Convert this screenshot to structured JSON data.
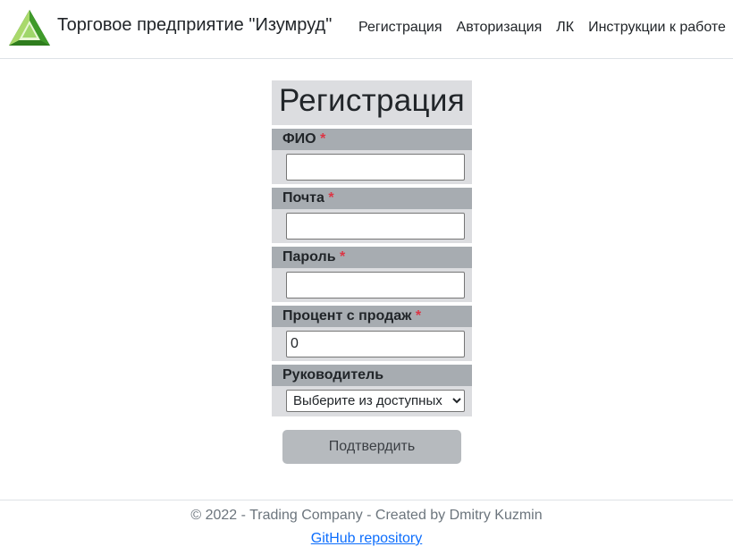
{
  "header": {
    "brand": "Торговое предприятие \"Изумруд\"",
    "nav": [
      {
        "label": "Регистрация"
      },
      {
        "label": "Авторизация"
      },
      {
        "label": "ЛК"
      },
      {
        "label": "Инструкции к работе"
      }
    ]
  },
  "form": {
    "title": "Регистрация",
    "required_marker": "*",
    "fields": [
      {
        "label": "ФИО",
        "value": ""
      },
      {
        "label": "Почта",
        "value": ""
      },
      {
        "label": "Пароль",
        "value": ""
      },
      {
        "label": "Процент с продаж",
        "value": "0"
      }
    ],
    "manager": {
      "label": "Руководитель",
      "selected": "Выберите из доступных"
    },
    "submit_label": "Подтвердить"
  },
  "footer": {
    "copyright": "© 2022 - Trading Company - Created by Dmitry Kuzmin",
    "github_link": "GitHub repository"
  },
  "colors": {
    "label_bg": "#a7acb1",
    "field_bg": "#dcdde0",
    "required": "#dc3545",
    "button_bg": "#b6babe",
    "link": "#0d6efd"
  },
  "icons": {
    "logo": "green-triangle-logo-icon"
  }
}
